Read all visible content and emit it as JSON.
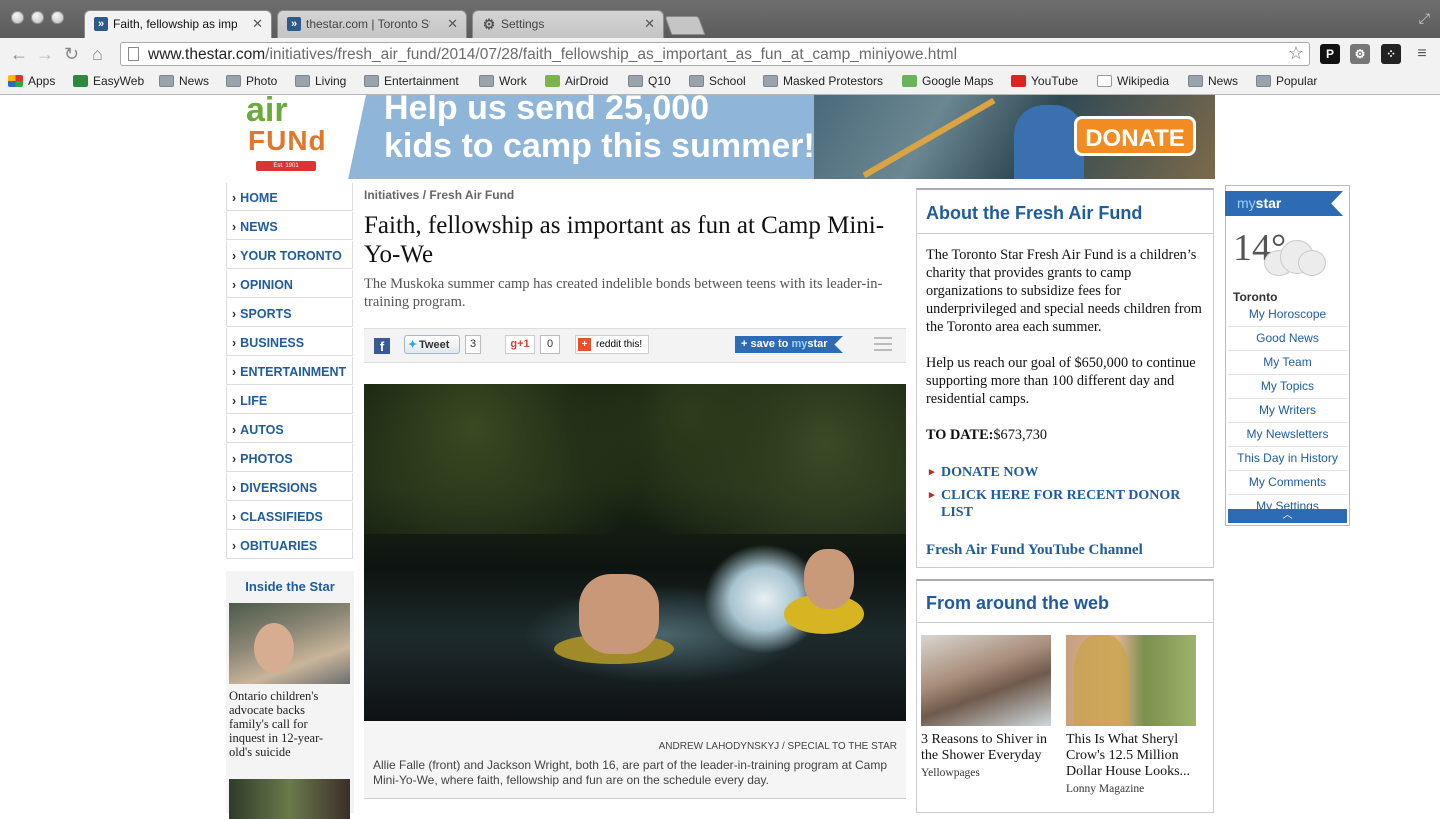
{
  "browser": {
    "tabs": [
      {
        "title": "Faith, fellowship as importa"
      },
      {
        "title": "thestar.com | Toronto Star"
      },
      {
        "title": "Settings"
      }
    ],
    "url_domain": "www.thestar.com",
    "url_path": "/initiatives/fresh_air_fund/2014/07/28/faith_fellowship_as_important_as_fun_at_camp_miniyowe.html",
    "bookmarks": [
      "Apps",
      "EasyWeb",
      "News",
      "Photo",
      "Living",
      "Entertainment",
      "Work",
      "AirDroid",
      "Q10",
      "School",
      "Masked Protestors",
      "Google Maps",
      "YouTube",
      "Wikipedia",
      "News",
      "Popular"
    ]
  },
  "banner": {
    "logo_top": "air",
    "logo_bottom": "FUNd",
    "logo_est": "Est. 1901",
    "headline_1": "Help us send 25,000",
    "headline_2": "kids to camp this summer!",
    "donate": "DONATE"
  },
  "nav": {
    "items": [
      "HOME",
      "NEWS",
      "YOUR TORONTO",
      "OPINION",
      "SPORTS",
      "BUSINESS",
      "ENTERTAINMENT",
      "LIFE",
      "AUTOS",
      "PHOTOS",
      "DIVERSIONS",
      "CLASSIFIEDS",
      "OBITUARIES"
    ]
  },
  "inside": {
    "title": "Inside the Star",
    "story": "Ontario children's advocate backs family's call for inquest in 12-year-old's suicide"
  },
  "article": {
    "breadcrumb": "Initiatives / Fresh Air Fund",
    "headline": "Faith, fellowship as important as fun at Camp Mini-Yo-We",
    "dek": "The Muskoka summer camp has created indelible bonds between teens with its leader-in-training program.",
    "share": {
      "fb": "f",
      "tweet": "Tweet",
      "tweet_count": "3",
      "gplus": "+1",
      "gplus_count": "0",
      "reddit": "reddit this!",
      "save_prefix": "+ save to ",
      "save_my": "my",
      "save_star": "star"
    },
    "photo_credit": "ANDREW LAHODYNSKYJ / SPECIAL TO THE STAR",
    "caption": "Allie Falle (front) and Jackson Wright, both 16, are part of the leader-in-training program at Camp Mini-Yo-We, where faith, fellowship and fun are on the schedule every day."
  },
  "about": {
    "title": "About the Fresh Air Fund",
    "p1": "The Toronto Star Fresh Air Fund is a children’s charity that provides grants to camp organizations to subsidize fees for underprivileged and special needs children from the Toronto area each summer.",
    "p2": "Help us reach our goal of $650,000 to continue supporting more than 100 different day and residential camps.",
    "todate_label": "TO DATE:",
    "todate_value": "$673,730",
    "link1": "DONATE NOW",
    "link2": "CLICK HERE FOR RECENT DONOR LIST",
    "youtube": "Fresh Air Fund YouTube Channel"
  },
  "web": {
    "title": "From around the web",
    "items": [
      {
        "headline": "3 Reasons to Shiver in the Shower Everyday",
        "source": "Yellowpages"
      },
      {
        "headline": "This Is What Sheryl Crow's 12.5 Million Dollar House Looks...",
        "source": "Lonny Magazine"
      }
    ]
  },
  "mystar": {
    "my": "my",
    "star": "star",
    "temperature": "14°",
    "city": "Toronto",
    "links": [
      "My Horoscope",
      "Good News",
      "My Team",
      "My Topics",
      "My Writers",
      "My Newsletters",
      "This Day in History",
      "My Comments",
      "My Settings"
    ],
    "collapse": "︿"
  },
  "colors": {
    "link": "#1f5b9e",
    "accent": "#2e6bb5",
    "donate": "#f28c22"
  }
}
